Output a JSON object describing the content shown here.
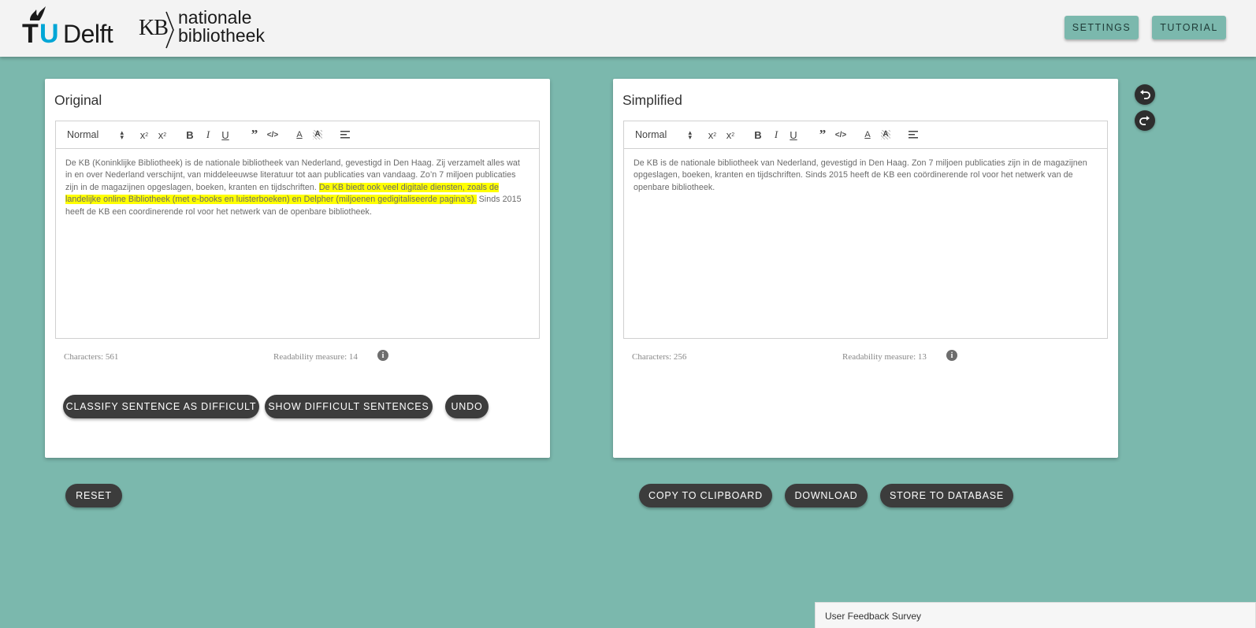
{
  "header": {
    "tu_logo": {
      "t": "T",
      "u": "U",
      "rest": "Delft"
    },
    "kb_logo": {
      "kb": "KB",
      "line1": "nationale",
      "line2": "bibliotheek"
    },
    "settings_label": "SETTINGS",
    "tutorial_label": "TUTORIAL",
    "accent_color": "#7bb8ad"
  },
  "original": {
    "title": "Original",
    "toolbar": {
      "format": "Normal"
    },
    "text_before": "De KB (Koninklijke Bibliotheek) is de nationale bibliotheek van Nederland, gevestigd in Den Haag. Zij verzamelt alles wat in en over Nederland verschijnt, van middeleeuwse literatuur tot aan publicaties van vandaag. Zo’n 7 miljoen publicaties zijn in de magazijnen opgeslagen, boeken, kranten en tijdschriften. ",
    "text_highlighted": "De KB biedt ook veel digitale diensten, zoals de landelijke online Bibliotheek (met e-books en luisterboeken) en Delpher (miljoenen gedigitaliseerde pagina’s).",
    "text_after": " Sinds 2015 heeft de KB een coordinerende rol voor het netwerk van de openbare bibliotheek.",
    "highlight_color": "#ffff00",
    "characters": "Characters: 561",
    "readability": "Readability measure: 14",
    "buttons": {
      "classify": "CLASSIFY SENTENCE AS DIFFICULT",
      "show": "SHOW DIFFICULT SENTENCES",
      "undo": "UNDO"
    }
  },
  "simplified": {
    "title": "Simplified",
    "toolbar": {
      "format": "Normal"
    },
    "text": "De KB is de nationale bibliotheek van Nederland, gevestigd in Den Haag. Zon 7 miljoen publicaties zijn in de magazijnen opgeslagen, boeken, kranten en tijdschriften. Sinds 2015 heeft de KB een coördinerende rol voor het netwerk van de openbare bibliotheek.",
    "characters": "Characters: 256",
    "readability": "Readability measure: 13"
  },
  "actions": {
    "reset": "RESET",
    "copy": "COPY TO CLIPBOARD",
    "download": "DOWNLOAD",
    "store": "STORE TO DATABASE"
  },
  "side_controls": {
    "undo_icon": "undo-icon",
    "redo_icon": "redo-icon"
  },
  "survey": {
    "label": "User Feedback Survey"
  }
}
